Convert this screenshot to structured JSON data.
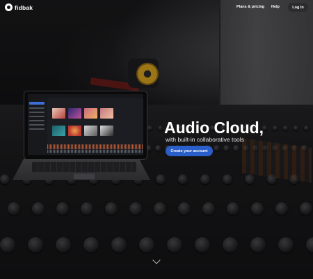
{
  "brand": {
    "name": "fidbak"
  },
  "nav": {
    "plans": "Plans & pricing",
    "help": "Help",
    "login": "Log In"
  },
  "hero": {
    "title": "Audio Cloud,",
    "subtitle": "with built-in collaborative tools",
    "cta": "Create your account"
  },
  "icons": {
    "logo": "fidbak-logo-icon",
    "scroll": "chevron-down-icon"
  },
  "colors": {
    "accent": "#2a5fc9",
    "background": "#141416"
  }
}
